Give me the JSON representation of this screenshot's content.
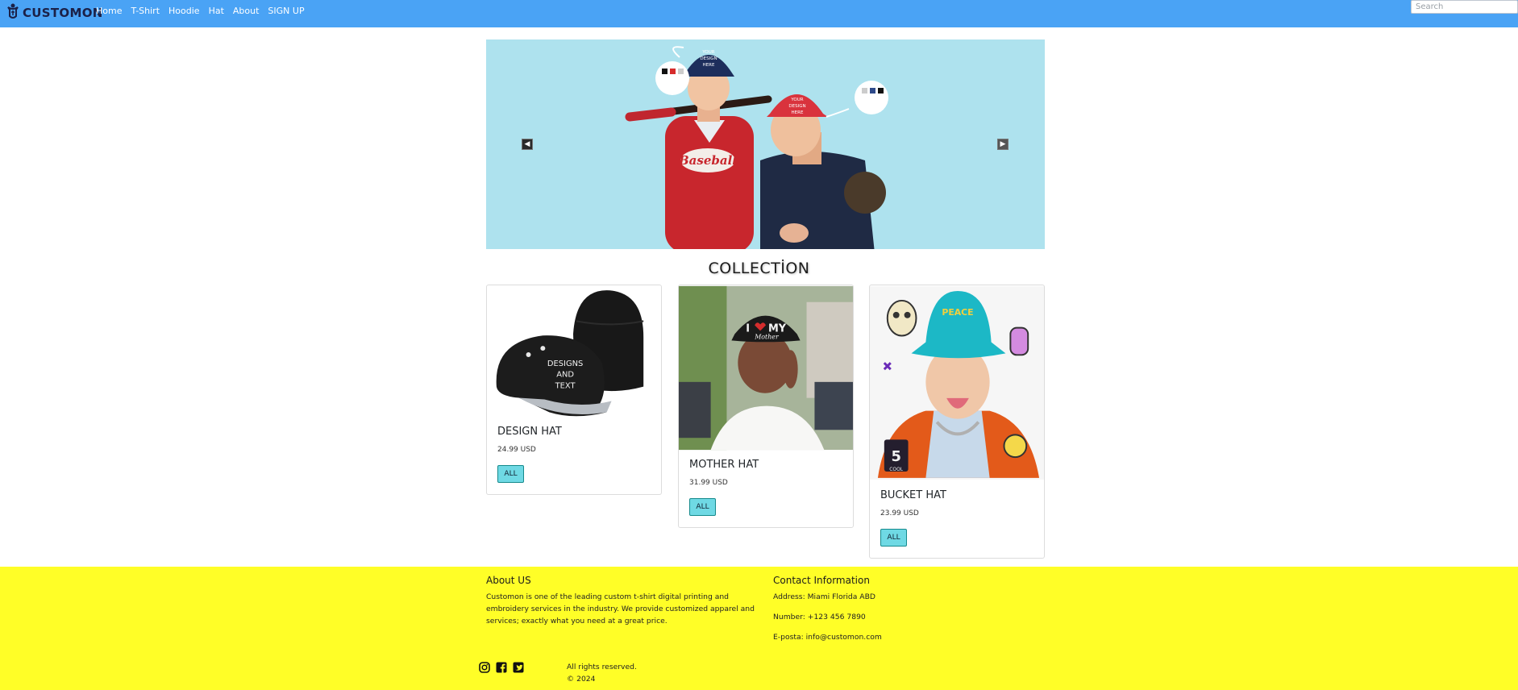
{
  "brand": {
    "name": "CUSTOMON",
    "text_color": "#1b2148"
  },
  "nav": {
    "items": [
      "Home",
      "T-Shirt",
      "Hoodie",
      "Hat",
      "About",
      "SIGN UP"
    ],
    "search_placeholder": "Search",
    "background": "#4aa3f5"
  },
  "carousel": {
    "background": "#aee2ee",
    "caps": [
      "YOUR DESIGN HERE",
      "YOUR DESIGN HERE"
    ],
    "shirt_text": "Baseball",
    "prev_icon": "chevron-left-icon",
    "next_icon": "chevron-right-icon"
  },
  "collection": {
    "title": "COLLECTİON",
    "products": [
      {
        "name": "DESIGN HAT",
        "price": "24.99 USD",
        "button": "ALL",
        "image_text": [
          "DESIGNS",
          "AND",
          "TEXT"
        ]
      },
      {
        "name": "MOTHER HAT",
        "price": "31.99 USD",
        "button": "ALL",
        "image_text": [
          "I",
          "MY",
          "Mother"
        ]
      },
      {
        "name": "BUCKET HAT",
        "price": "23.99 USD",
        "button": "ALL",
        "image_text": [
          "PEACE",
          "5",
          "COOL"
        ]
      }
    ],
    "button_color": "#6fd9e4"
  },
  "footer": {
    "background": "#fffe27",
    "about": {
      "title": "About US",
      "text_lines": [
        "Customon is one of the leading custom t-shirt digital printing and",
        "embroidery services in the industry. We provide customized apparel and",
        "services; exactly what you need at a great price."
      ]
    },
    "contact": {
      "title": "Contact Information",
      "address": "Address: Miami Florida ABD",
      "number": "Number: +123 456 7890",
      "email": "E-posta: info@customon.com"
    },
    "social_icons": [
      "instagram-icon",
      "facebook-icon",
      "twitter-icon"
    ],
    "rights": "All rights reserved.",
    "copyright": "© 2024"
  }
}
